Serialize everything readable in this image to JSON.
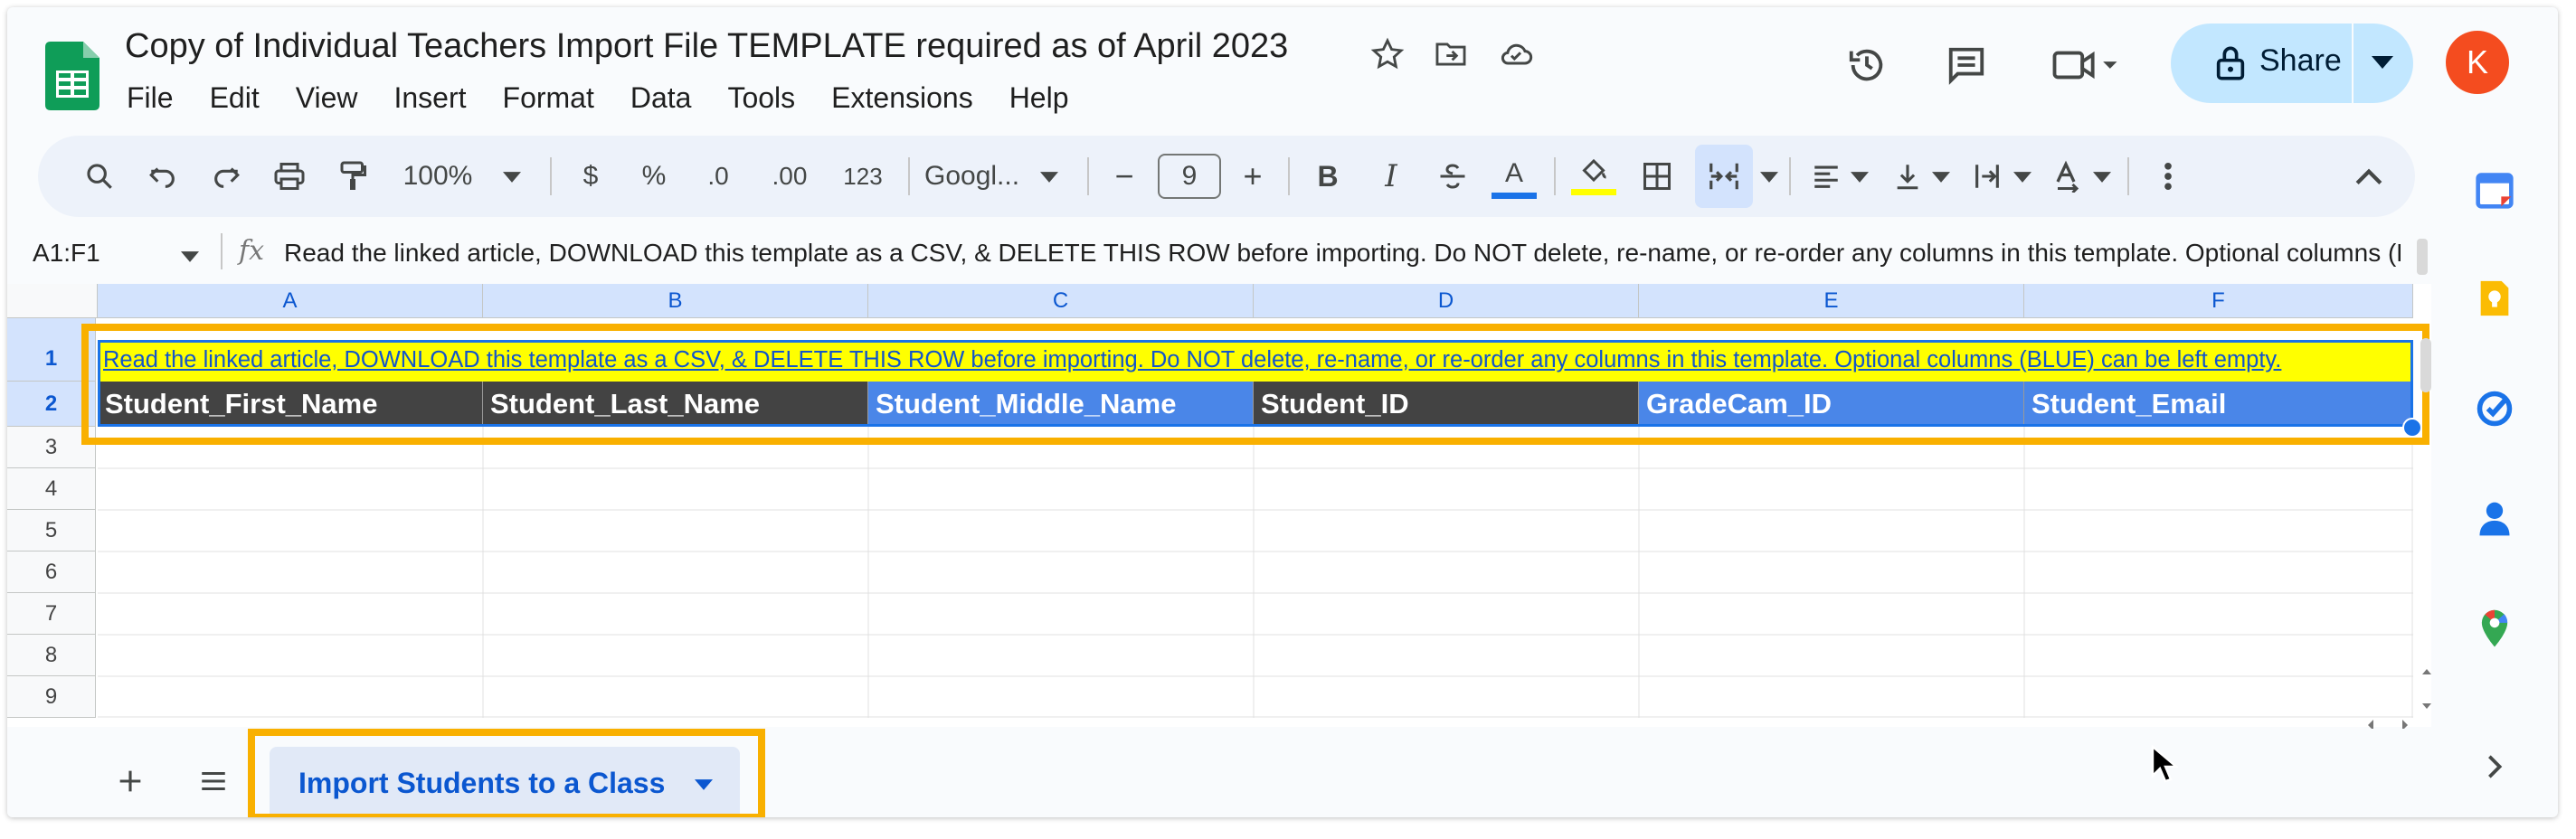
{
  "document": {
    "title": "Copy of Individual Teachers Import File TEMPLATE required as of April 2023",
    "menu": [
      "File",
      "Edit",
      "View",
      "Insert",
      "Format",
      "Data",
      "Tools",
      "Extensions",
      "Help"
    ],
    "share_label": "Share",
    "avatar_letter": "K"
  },
  "toolbar": {
    "zoom": "100%",
    "currency": "$",
    "percent": "%",
    "dec_decrease": ".0",
    "dec_increase": ".00",
    "number_format": "123",
    "font": "Googl...",
    "font_size": "9",
    "minus": "−",
    "plus": "+",
    "bold": "B",
    "italic": "I",
    "text_color_letter": "A"
  },
  "formula_bar": {
    "name_box": "A1:F1",
    "fx": "fx",
    "content": "Read the linked article, DOWNLOAD this template as a CSV, & DELETE THIS ROW before importing. Do NOT delete, re-name, or re-order any columns in this template. Optional columns (BLUE) can"
  },
  "grid": {
    "columns": [
      "A",
      "B",
      "C",
      "D",
      "E",
      "F"
    ],
    "rows": [
      "1",
      "2",
      "3",
      "4",
      "5",
      "6",
      "7",
      "8",
      "9"
    ],
    "row1_text": "Read the linked article, DOWNLOAD this template as a CSV, & DELETE THIS ROW before importing. Do NOT delete, re-name, or re-order any columns in this template. Optional columns (BLUE) can be left empty.",
    "headers": [
      "Student_First_Name",
      "Student_Last_Name",
      "Student_Middle_Name",
      "Student_ID",
      "GradeCam_ID",
      "Student_Email"
    ]
  },
  "sheet_tab": {
    "label": "Import Students to a Class"
  },
  "colors": {
    "header_dark": "#434343",
    "header_blue": "#4a86e8",
    "row1_fill": "#ffff00",
    "highlight": "#f9b000",
    "share_bg": "#c2e7ff"
  }
}
